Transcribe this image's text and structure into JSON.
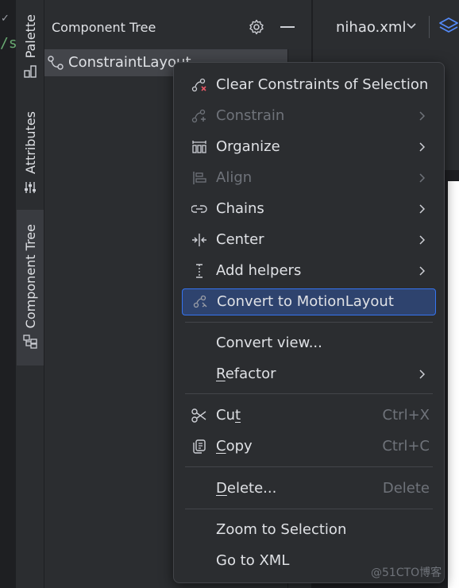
{
  "left_strip": {
    "code_fragment": "/s",
    "check_mark": "✓"
  },
  "side_tabs": [
    {
      "label": "Palette",
      "icon": "palette-icon"
    },
    {
      "label": "Attributes",
      "icon": "sliders-icon"
    },
    {
      "label": "Component Tree",
      "icon": "component-tree-icon"
    }
  ],
  "component_tree": {
    "title": "Component Tree",
    "icons": [
      "gear-icon",
      "minimize-icon"
    ],
    "root": {
      "label": "ConstraintLayout",
      "icon": "constraint-layout-icon"
    }
  },
  "editor": {
    "file_tab": "nihao.xml",
    "icons": [
      "chevron-down-icon",
      "layers-icon"
    ]
  },
  "context_menu": {
    "items": [
      {
        "label": "Clear Constraints of Selection",
        "icon": "clear-constraints-icon",
        "enabled": true,
        "submenu": false
      },
      {
        "label": "Constrain",
        "icon": "constrain-icon",
        "enabled": false,
        "submenu": true
      },
      {
        "label": "Organize",
        "icon": "organize-icon",
        "enabled": true,
        "submenu": true
      },
      {
        "label": "Align",
        "icon": "align-icon",
        "enabled": false,
        "submenu": true
      },
      {
        "label": "Chains",
        "icon": "chains-icon",
        "enabled": true,
        "submenu": true
      },
      {
        "label": "Center",
        "icon": "center-icon",
        "enabled": true,
        "submenu": true
      },
      {
        "label": "Add helpers",
        "icon": "add-helpers-icon",
        "enabled": true,
        "submenu": true
      },
      {
        "label": "Convert to MotionLayout",
        "icon": "motion-layout-icon",
        "enabled": true,
        "submenu": false,
        "selected": true
      },
      {
        "label": "Convert view...",
        "enabled": true,
        "submenu": false
      },
      {
        "label": "Refactor",
        "enabled": true,
        "submenu": true,
        "mnemonic": "R"
      },
      {
        "label": "Cut",
        "icon": "scissors-icon",
        "shortcut": "Ctrl+X",
        "mnemonic": "t"
      },
      {
        "label": "Copy",
        "icon": "copy-icon",
        "shortcut": "Ctrl+C",
        "mnemonic": "C"
      },
      {
        "label": "Delete...",
        "shortcut": "Delete",
        "mnemonic": "D"
      },
      {
        "label": "Zoom to Selection"
      },
      {
        "label": "Go to XML"
      }
    ]
  },
  "watermark": "@51CTO博客",
  "colors": {
    "accent": "#3574f0",
    "selection": "#2e436e",
    "panel": "#2b2d30",
    "background": "#1e1f22",
    "text": "#dfe1e5",
    "disabled_text": "#6f737a"
  }
}
